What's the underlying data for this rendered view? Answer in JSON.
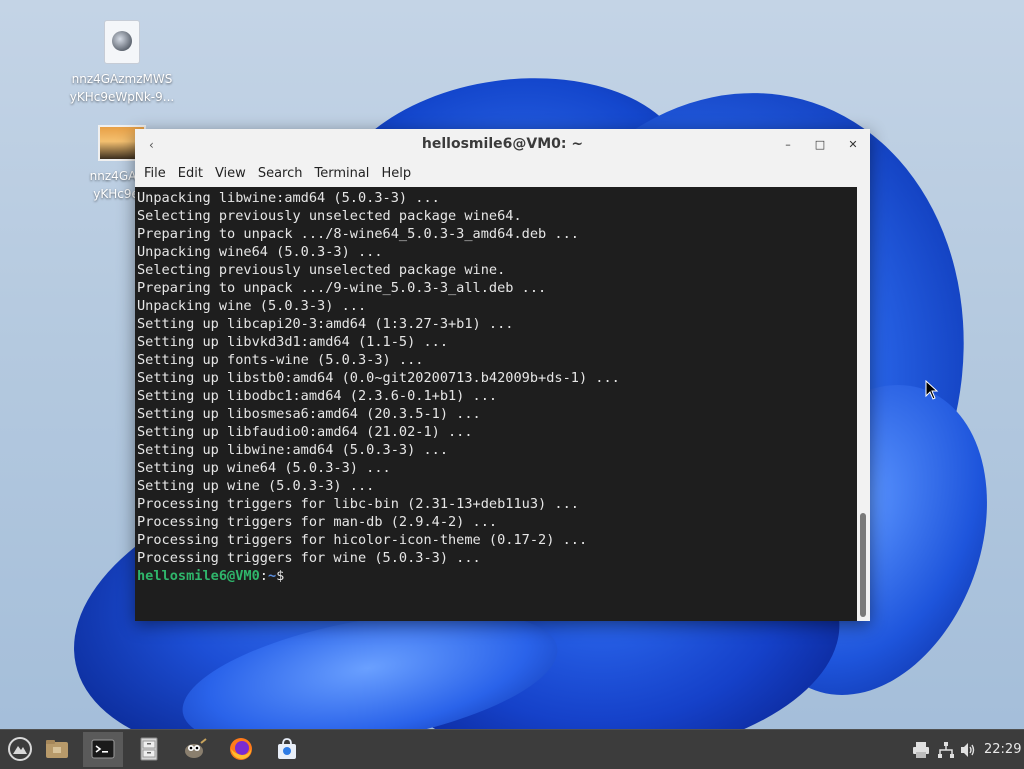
{
  "desktop": {
    "icons": [
      {
        "label_line1": "nnz4GAzmzMWS",
        "label_line2": "yKHc9eWpNk-9..."
      },
      {
        "label_line1": "nnz4GAzm",
        "label_line2": "yKHc9eW"
      }
    ]
  },
  "window": {
    "title": "hellosmile6@VM0: ~",
    "menu_icon": "‹",
    "buttons": {
      "minimize": "–",
      "maximize": "□",
      "close": "✕"
    }
  },
  "menubar": {
    "items": [
      "File",
      "Edit",
      "View",
      "Search",
      "Terminal",
      "Help"
    ]
  },
  "terminal": {
    "lines": [
      "Unpacking libwine:amd64 (5.0.3-3) ...",
      "Selecting previously unselected package wine64.",
      "Preparing to unpack .../8-wine64_5.0.3-3_amd64.deb ...",
      "Unpacking wine64 (5.0.3-3) ...",
      "Selecting previously unselected package wine.",
      "Preparing to unpack .../9-wine_5.0.3-3_all.deb ...",
      "Unpacking wine (5.0.3-3) ...",
      "Setting up libcapi20-3:amd64 (1:3.27-3+b1) ...",
      "Setting up libvkd3d1:amd64 (1.1-5) ...",
      "Setting up fonts-wine (5.0.3-3) ...",
      "Setting up libstb0:amd64 (0.0~git20200713.b42009b+ds-1) ...",
      "Setting up libodbc1:amd64 (2.3.6-0.1+b1) ...",
      "Setting up libosmesa6:amd64 (20.3.5-1) ...",
      "Setting up libfaudio0:amd64 (21.02-1) ...",
      "Setting up libwine:amd64 (5.0.3-3) ...",
      "Setting up wine64 (5.0.3-3) ...",
      "Setting up wine (5.0.3-3) ...",
      "Processing triggers for libc-bin (2.31-13+deb11u3) ...",
      "Processing triggers for man-db (2.9.4-2) ...",
      "Processing triggers for hicolor-icon-theme (0.17-2) ...",
      "Processing triggers for wine (5.0.3-3) ..."
    ],
    "prompt": {
      "user": "hellosmile6@VM0",
      "sep": ":",
      "path": "~",
      "symbol": "$ "
    }
  },
  "taskbar": {
    "items": [
      {
        "name": "app-menu-icon"
      },
      {
        "name": "file-manager-icon"
      },
      {
        "name": "terminal-icon"
      },
      {
        "name": "file-cabinet-icon"
      },
      {
        "name": "gimp-icon"
      },
      {
        "name": "firefox-icon"
      },
      {
        "name": "software-store-icon"
      }
    ],
    "tray": {
      "clock": "22:29",
      "icons": [
        "printer-icon",
        "network-icon",
        "volume-icon"
      ]
    }
  },
  "colors": {
    "prompt_user": "#2fb56b",
    "prompt_path": "#5c8fe0",
    "terminal_bg": "#1e1e1e",
    "terminal_fg": "#e6e6e6",
    "taskbar_bg": "#3c3c3c"
  }
}
